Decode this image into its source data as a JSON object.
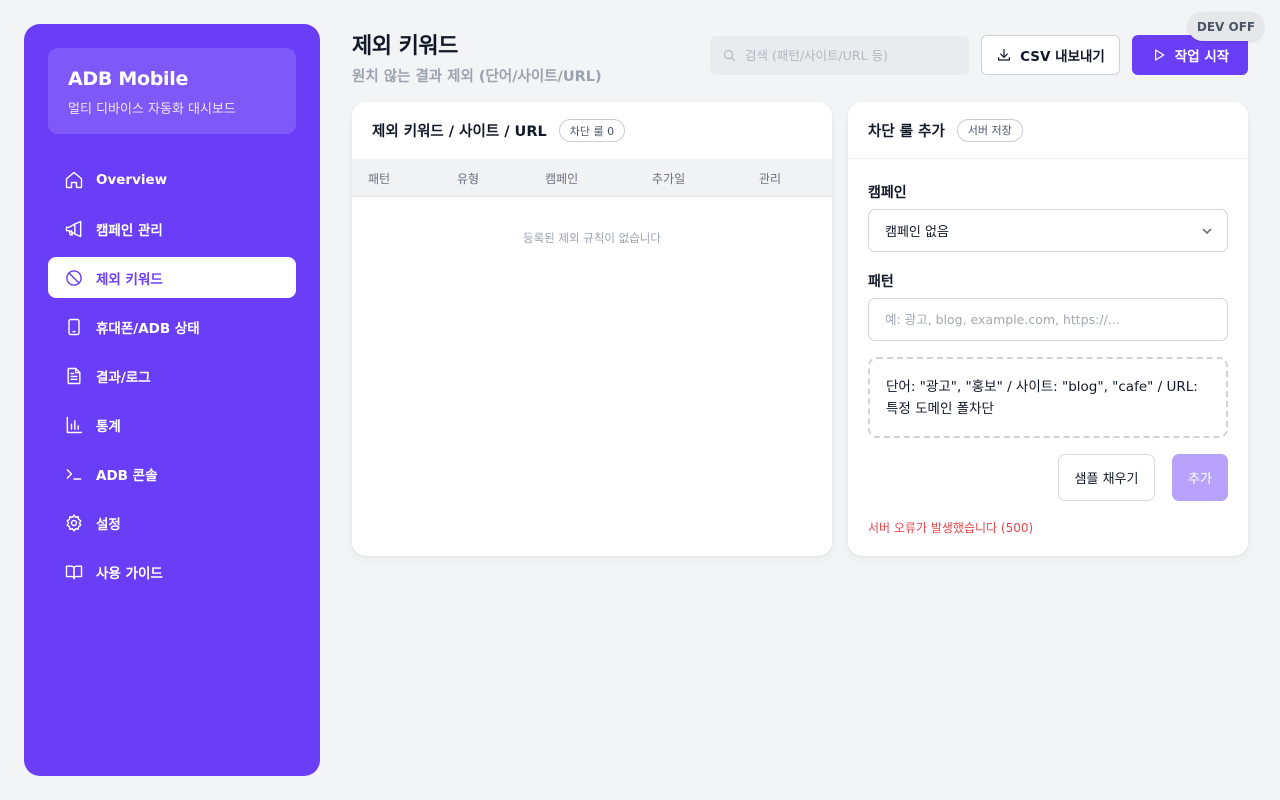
{
  "sidebar": {
    "brand_title": "ADB Mobile",
    "brand_subtitle": "멀티 디바이스 자동화 대시보드",
    "items": [
      {
        "label": "Overview",
        "icon": "home-icon"
      },
      {
        "label": "캠페인 관리",
        "icon": "megaphone-icon"
      },
      {
        "label": "제외 키워드",
        "icon": "ban-icon"
      },
      {
        "label": "휴대폰/ADB 상태",
        "icon": "smartphone-icon"
      },
      {
        "label": "결과/로그",
        "icon": "file-text-icon"
      },
      {
        "label": "통계",
        "icon": "bar-chart-icon"
      },
      {
        "label": "ADB 콘솔",
        "icon": "terminal-icon"
      },
      {
        "label": "설정",
        "icon": "gear-icon"
      },
      {
        "label": "사용 가이드",
        "icon": "book-icon"
      }
    ],
    "active_index": 2
  },
  "header": {
    "title": "제외 키워드",
    "subtitle": "원치 않는 결과 제외 (단어/사이트/URL)",
    "search_placeholder": "검색 (패턴/사이트/URL 등)",
    "csv_button": "CSV 내보내기",
    "start_button": "작업 시작",
    "dev_badge": "DEV OFF"
  },
  "rules_card": {
    "title": "제외 키워드 / 사이트 / URL",
    "count_badge": "차단 룰 0",
    "columns": [
      "패턴",
      "유형",
      "캠페인",
      "추가일",
      "관리"
    ],
    "empty_message": "등록된 제외 규칙이 없습니다"
  },
  "add_card": {
    "title": "차단 룰 추가",
    "badge": "서버 저장",
    "campaign_label": "캠페인",
    "campaign_value": "캠페인 없음",
    "pattern_label": "패턴",
    "pattern_placeholder": "예: 광고, blog, example.com, https://...",
    "pattern_value": "",
    "hint": "단어: \"광고\", \"홍보\" / 사이트: \"blog\", \"cafe\" / URL: 특정 도메인 폴차단",
    "sample_button": "샘플 채우기",
    "add_button": "추가",
    "error": "서버 오류가 발생했습니다 (500)"
  },
  "colors": {
    "accent": "#6a3ef7",
    "accent_disabled": "#b7a3fb",
    "error": "#e5484d",
    "background": "#f3f4f6"
  }
}
